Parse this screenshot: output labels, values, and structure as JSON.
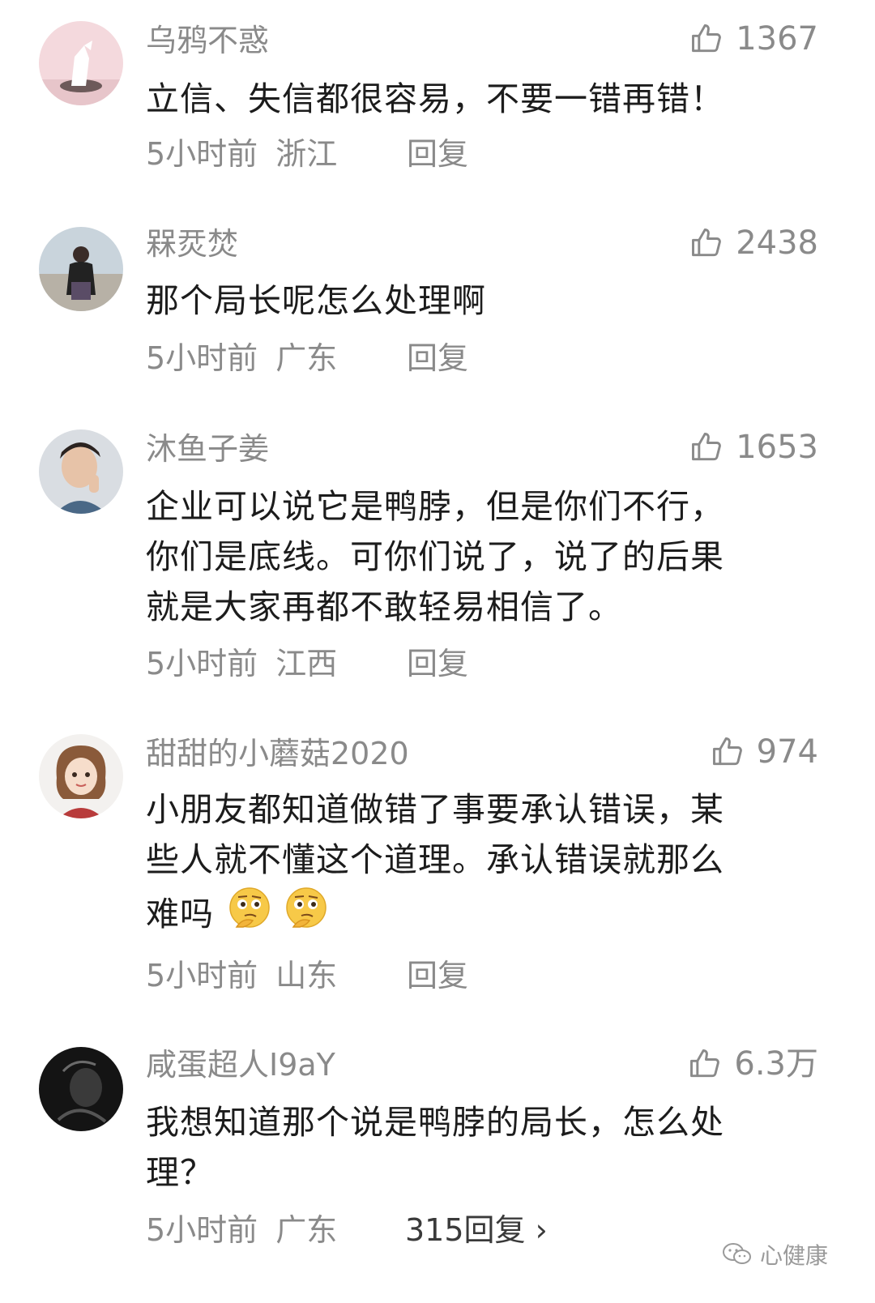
{
  "comments": [
    {
      "username": "乌鸦不惑",
      "likes": "1367",
      "text_lines": [
        "立信、失信都很容易，不要一错再错！"
      ],
      "time": "5小时前",
      "location": "浙江",
      "reply_label": "回复"
    },
    {
      "username": "槑烎焚",
      "likes": "2438",
      "text_lines": [
        "那个局长呢怎么处理啊"
      ],
      "time": "5小时前",
      "location": "广东",
      "reply_label": "回复"
    },
    {
      "username": "沐鱼子姜",
      "likes": "1653",
      "text_lines": [
        "企业可以说它是鸭脖，但是你们不行，",
        "你们是底线。可你们说了，说了的后果",
        "就是大家再都不敢轻易相信了。"
      ],
      "time": "5小时前",
      "location": "江西",
      "reply_label": "回复"
    },
    {
      "username": "甜甜的小蘑菇2020",
      "likes": "974",
      "text_lines": [
        "小朋友都知道做错了事要承认错误，某",
        "些人就不懂这个道理。承认错误就那么",
        "难吗"
      ],
      "emoji": "thinking-emoji",
      "time": "5小时前",
      "location": "山东",
      "reply_label": "回复"
    },
    {
      "username": "咸蛋超人I9aY",
      "likes": "6.3万",
      "text_lines": [
        "我想知道那个说是鸭脖的局长，怎么处",
        "理？"
      ],
      "time": "5小时前",
      "location": "广东",
      "reply_label": "315回复 ›"
    }
  ],
  "watermark": {
    "text": "心健康",
    "icon": "wechat-icon"
  },
  "colors": {
    "secondary_text": "#8a8a8a",
    "primary_text": "#1c1c1c"
  }
}
